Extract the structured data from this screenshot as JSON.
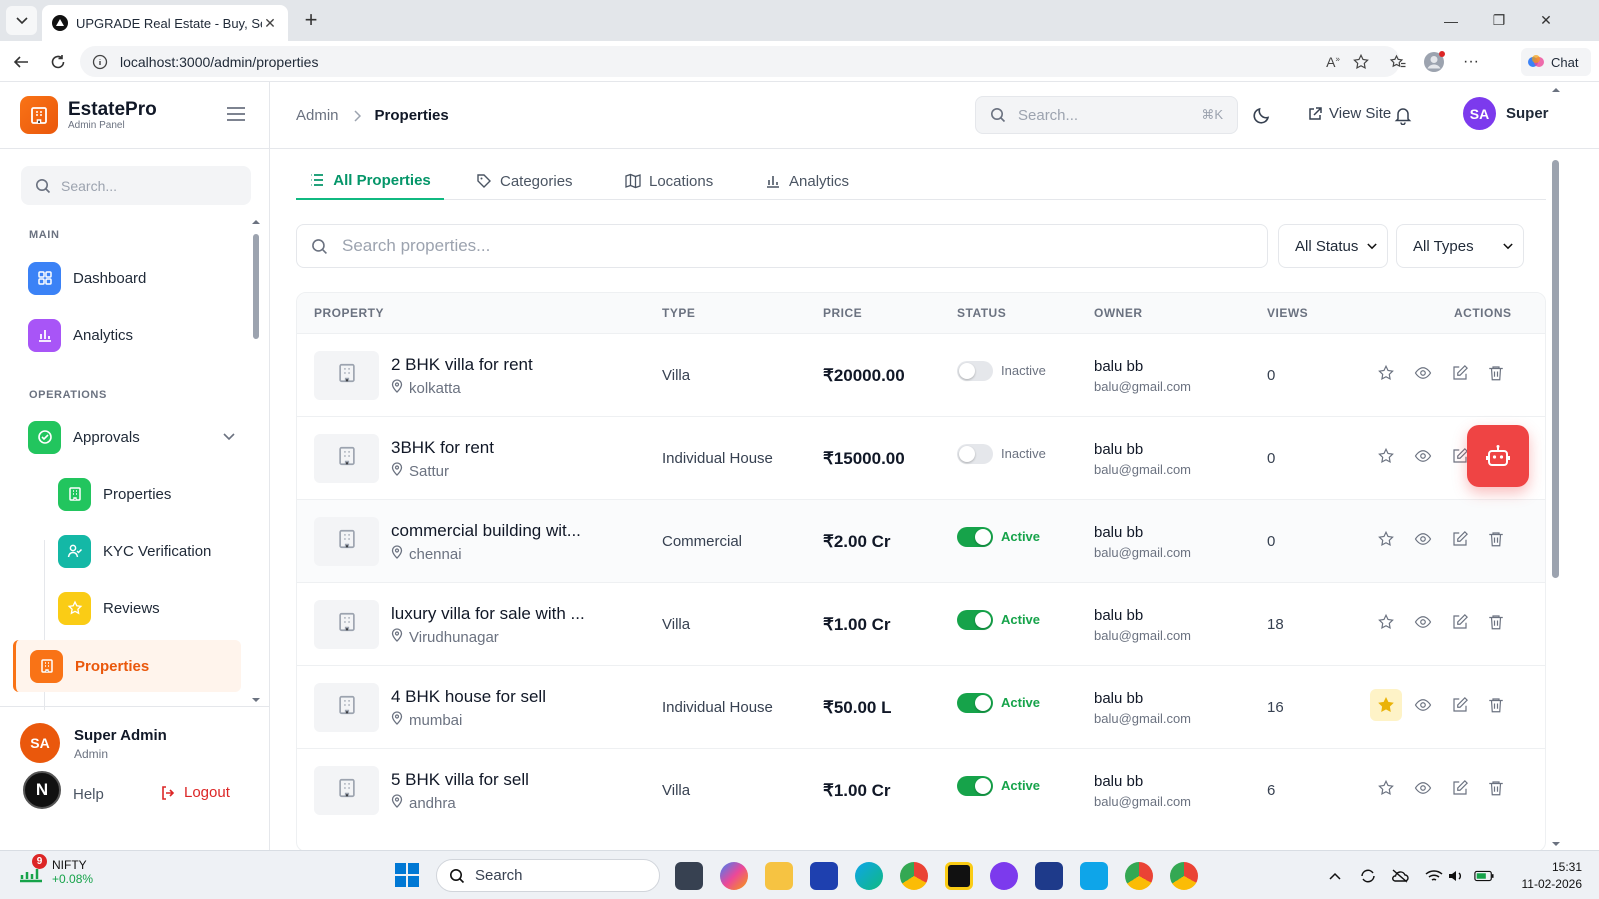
{
  "browser": {
    "tab_title": "UPGRADE Real Estate - Buy, Sell & ...",
    "url": "localhost:3000/admin/properties",
    "chat_label": "Chat"
  },
  "sidebar": {
    "brand_name": "EstatePro",
    "brand_sub": "Admin Panel",
    "search_placeholder": "Search...",
    "main_label": "MAIN",
    "operations_label": "OPERATIONS",
    "items": {
      "dashboard": "Dashboard",
      "analytics": "Analytics",
      "approvals": "Approvals",
      "approvals_properties": "Properties",
      "kyc": "KYC Verification",
      "reviews": "Reviews",
      "properties": "Properties"
    },
    "user": {
      "initials": "SA",
      "name": "Super Admin",
      "role": "Admin"
    },
    "n_badge": "N",
    "help": "Help",
    "logout": "Logout"
  },
  "header": {
    "breadcrumb_root": "Admin",
    "breadcrumb_current": "Properties",
    "search_placeholder": "Search...",
    "search_shortcut": "⌘K",
    "view_site": "View Site",
    "avatar_initials": "SA",
    "user_name": "Super"
  },
  "tabs": [
    "All Properties",
    "Categories",
    "Locations",
    "Analytics"
  ],
  "filters": {
    "search_placeholder": "Search properties...",
    "status": "All Status",
    "types": "All Types"
  },
  "table": {
    "headers": [
      "PROPERTY",
      "TYPE",
      "PRICE",
      "STATUS",
      "OWNER",
      "VIEWS",
      "ACTIONS"
    ],
    "rows": [
      {
        "title": "2 BHK villa for rent",
        "location": "kolkatta",
        "type": "Villa",
        "price": "₹20000.00",
        "status": "Inactive",
        "active": false,
        "owner": "balu bb",
        "email": "balu@gmail.com",
        "views": "0",
        "featured": false
      },
      {
        "title": "3BHK for rent",
        "location": "Sattur",
        "type": "Individual House",
        "price": "₹15000.00",
        "status": "Inactive",
        "active": false,
        "owner": "balu bb",
        "email": "balu@gmail.com",
        "views": "0",
        "featured": false
      },
      {
        "title": "commercial building wit...",
        "location": "chennai",
        "type": "Commercial",
        "price": "₹2.00 Cr",
        "status": "Active",
        "active": true,
        "owner": "balu bb",
        "email": "balu@gmail.com",
        "views": "0",
        "featured": false
      },
      {
        "title": "luxury villa for sale with ...",
        "location": "Virudhunagar",
        "type": "Villa",
        "price": "₹1.00 Cr",
        "status": "Active",
        "active": true,
        "owner": "balu bb",
        "email": "balu@gmail.com",
        "views": "18",
        "featured": false
      },
      {
        "title": "4 BHK house for sell",
        "location": "mumbai",
        "type": "Individual House",
        "price": "₹50.00 L",
        "status": "Active",
        "active": true,
        "owner": "balu bb",
        "email": "balu@gmail.com",
        "views": "16",
        "featured": true
      },
      {
        "title": "5 BHK villa for sell",
        "location": "andhra",
        "type": "Villa",
        "price": "₹1.00 Cr",
        "status": "Active",
        "active": true,
        "owner": "balu bb",
        "email": "balu@gmail.com",
        "views": "6",
        "featured": false
      }
    ]
  },
  "taskbar": {
    "nifty_badge": "9",
    "nifty_name": "NIFTY",
    "nifty_change": "+0.08%",
    "search_label": "Search",
    "time": "15:31",
    "date": "11-02-2026"
  },
  "colors": {
    "accent": "#f97316",
    "active_tab": "#059669",
    "active_status": "#16a34a",
    "robot": "#ef4444"
  }
}
